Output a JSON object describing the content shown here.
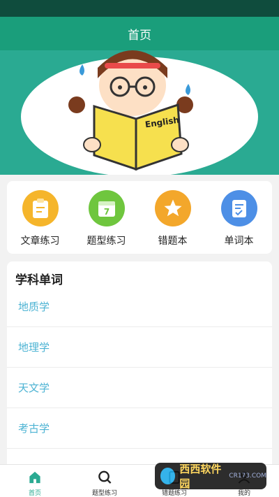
{
  "header": {
    "title": "首页"
  },
  "banner": {
    "book_text": "English"
  },
  "quick_actions": [
    {
      "label": "文章练习",
      "icon": "clipboard-icon",
      "color": "#f5b52b"
    },
    {
      "label": "题型练习",
      "icon": "calendar-icon",
      "color": "#6fc63e"
    },
    {
      "label": "错题本",
      "icon": "star-icon",
      "color": "#f3a72b"
    },
    {
      "label": "单词本",
      "icon": "checklist-icon",
      "color": "#4d8fe6"
    }
  ],
  "subject_words": {
    "title": "学科单词",
    "items": [
      "地质学",
      "地理学",
      "天文学",
      "考古学"
    ]
  },
  "calendar_number": "7",
  "tab_bar": {
    "tabs": [
      {
        "label": "首页",
        "icon": "home-icon",
        "active": true
      },
      {
        "label": "题型练习",
        "icon": "search-icon",
        "active": false
      },
      {
        "label": "错题练习",
        "icon": "book-icon",
        "active": false
      },
      {
        "label": "我的",
        "icon": "user-icon",
        "active": false
      }
    ]
  },
  "watermark": {
    "text": "西西软件园",
    "sub": "CR173.COM"
  },
  "colors": {
    "primary": "#1a9e7b",
    "banner_bg": "#2aaa92",
    "link": "#4cb3d3"
  }
}
